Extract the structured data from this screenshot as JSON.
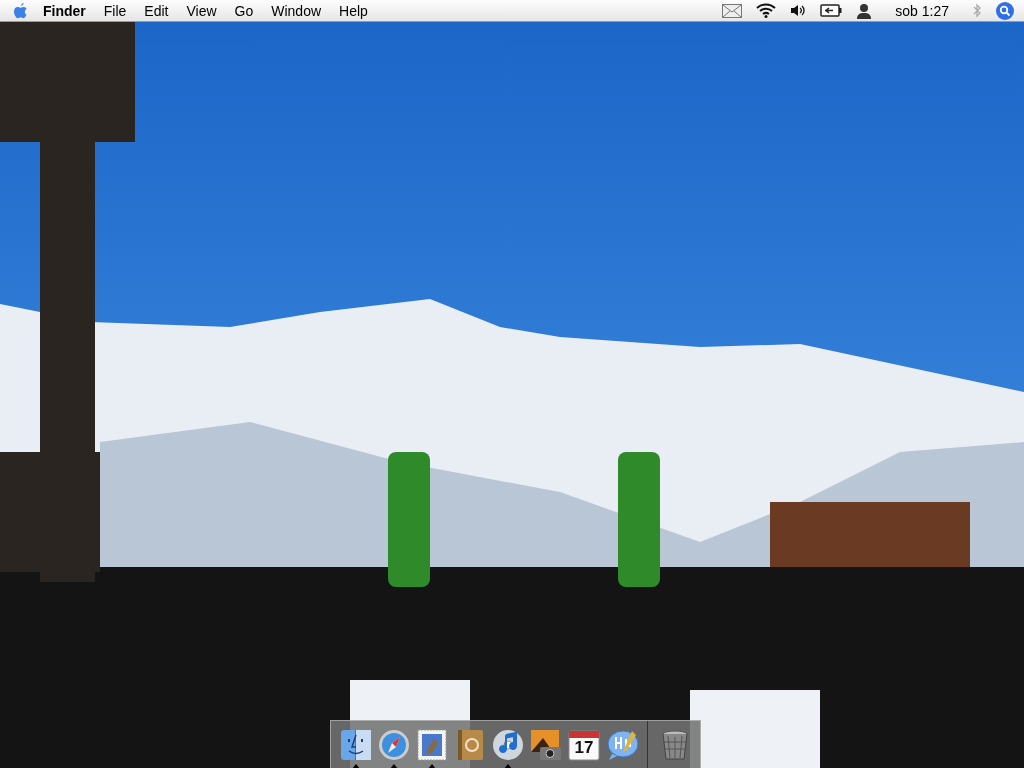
{
  "menu_bar": {
    "app_name": "Finder",
    "menus": [
      "File",
      "Edit",
      "View",
      "Go",
      "Window",
      "Help"
    ],
    "clock": "sob 1:27"
  },
  "dock": {
    "apps": [
      {
        "kind": "face",
        "running": true
      },
      {
        "kind": "compass",
        "running": true
      },
      {
        "kind": "stamp",
        "running": true
      },
      {
        "kind": "book",
        "running": false
      },
      {
        "kind": "disc",
        "running": true
      },
      {
        "kind": "camera",
        "running": false
      },
      {
        "kind": "calendar",
        "running": false,
        "day": "17"
      },
      {
        "kind": "chat",
        "running": false
      }
    ]
  }
}
